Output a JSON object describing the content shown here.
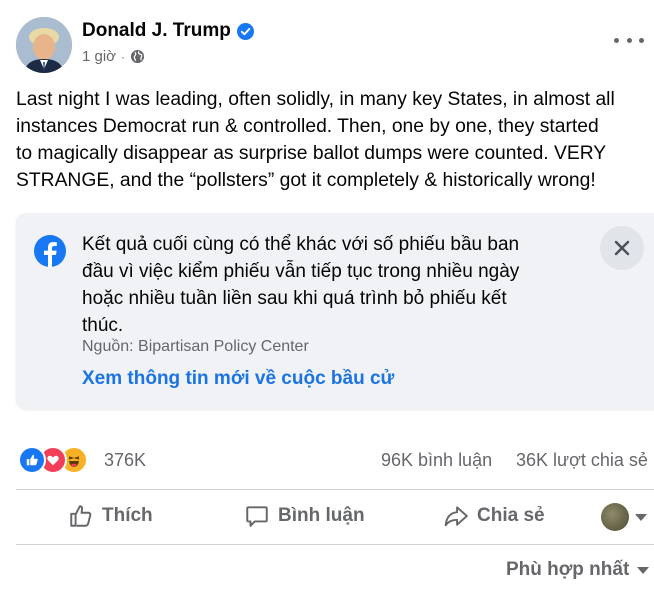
{
  "post": {
    "author": "Donald J. Trump",
    "time": "1 giờ",
    "text_lines": [
      "Last night I was leading, often solidly, in many key States, in almost all",
      "instances Democrat run & controlled. Then, one by one, they started",
      "to magically disappear as surprise ballot dumps were counted. VERY",
      "STRANGE, and the “pollsters” got it completely & historically wrong!"
    ]
  },
  "info_card": {
    "text_lines": [
      "Kết quả cuối cùng có thể khác với số phiếu bầu ban",
      "đầu vì việc kiểm phiếu vẫn tiếp tục trong nhiều ngày",
      "hoặc nhiều tuần liền sau khi quá trình bỏ phiếu kết",
      "thúc."
    ],
    "source": "Nguồn: Bipartisan Policy Center",
    "link": "Xem thông tin mới về cuộc bầu cử"
  },
  "stats": {
    "reactions": "376K",
    "comments": "96K bình luận",
    "shares": "36K lượt chia sẻ"
  },
  "actions": {
    "like": "Thích",
    "comment": "Bình luận",
    "share": "Chia sẻ"
  },
  "sort_label": "Phù hợp nhất",
  "colors": {
    "link_blue": "#1b74e4",
    "verified_blue": "#1877f2",
    "like_blue": "#1877f2",
    "love_red": "#f33e58",
    "haha_yellow": "#f7b125",
    "muted_text": "#65676b",
    "card_bg": "#f0f2f5"
  }
}
